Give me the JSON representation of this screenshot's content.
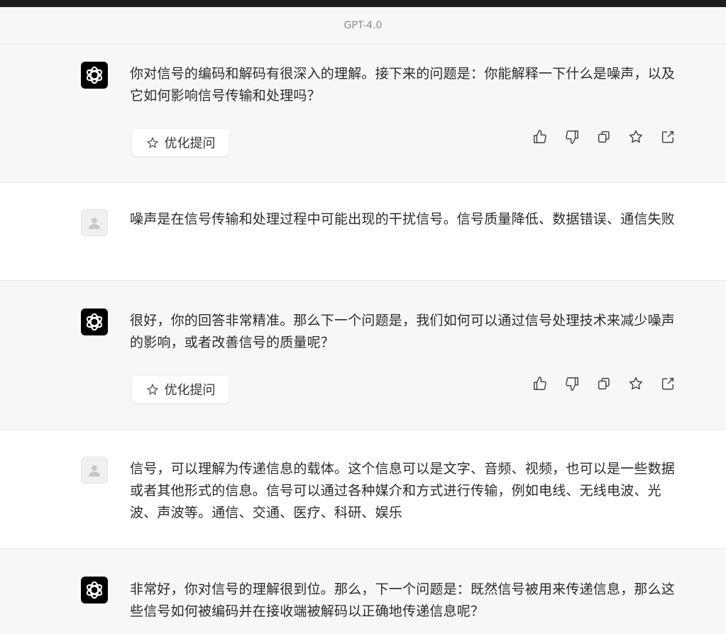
{
  "header": {
    "model_name": "GPT-4.0"
  },
  "messages": [
    {
      "role": "assistant",
      "text": "你对信号的编码和解码有很深入的理解。接下来的问题是：你能解释一下什么是噪声，以及它如何影响信号传输和处理吗？",
      "optimize_label": "优化提问"
    },
    {
      "role": "user",
      "text": "噪声是在信号传输和处理过程中可能出现的干扰信号。信号质量降低、数据错误、通信失败"
    },
    {
      "role": "assistant",
      "text": "很好，你的回答非常精准。那么下一个问题是，我们如何可以通过信号处理技术来减少噪声的影响，或者改善信号的质量呢？",
      "optimize_label": "优化提问"
    },
    {
      "role": "user",
      "text": "信号，可以理解为传递信息的载体。这个信息可以是文字、音频、视频，也可以是一些数据或者其他形式的信息。信号可以通过各种媒介和方式进行传输，例如电线、无线电波、光波、声波等。通信、交通、医疗、科研、娱乐"
    },
    {
      "role": "assistant",
      "text": "非常好，你对信号的理解很到位。那么，下一个问题是：既然信号被用来传递信息，那么这些信号如何被编码并在接收端被解码以正确地传递信息呢？"
    }
  ],
  "icons": {
    "assistant_avatar": "openai-logo-icon",
    "user_avatar": "user-silhouette-icon",
    "optimize": "sparkle-pin-icon",
    "actions": [
      "thumbs-up-icon",
      "thumbs-down-icon",
      "copy-icon",
      "star-icon",
      "share-icon"
    ]
  },
  "colors": {
    "assistant_bg": "#f7f7f8",
    "user_bg": "#ffffff",
    "topbar": "#1e1e1e",
    "text": "#2b2b2b"
  }
}
